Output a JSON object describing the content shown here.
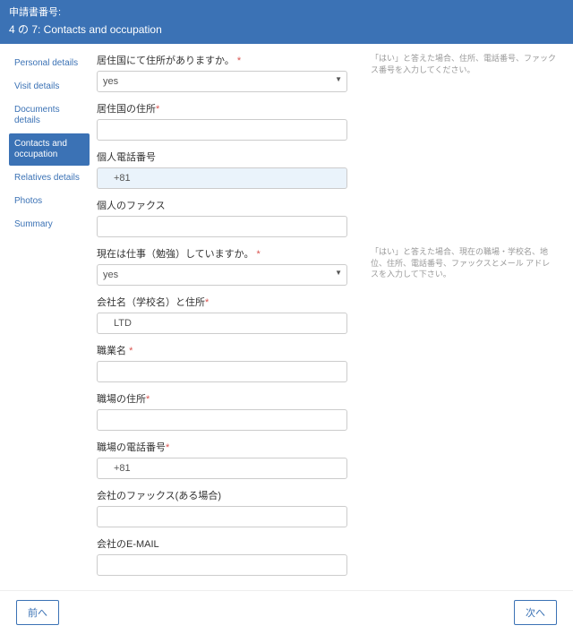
{
  "header": {
    "appno_label": "申請書番号:",
    "step": "4 の 7: Contacts and occupation"
  },
  "sidebar": {
    "items": [
      {
        "label": "Personal details"
      },
      {
        "label": "Visit details"
      },
      {
        "label": "Documents details"
      },
      {
        "label": "Contacts and occupation"
      },
      {
        "label": "Relatives details"
      },
      {
        "label": "Photos"
      },
      {
        "label": "Summary"
      }
    ],
    "active_index": 3
  },
  "form": {
    "q_has_address": {
      "label": "居住国にて住所がありますか。",
      "required": "*",
      "value": "yes",
      "hint": "「はい」と答えた場合、住所、電話番号、ファックス番号を入力してください。"
    },
    "home_address": {
      "label": "居住国の住所",
      "required": "*",
      "value": ""
    },
    "personal_phone": {
      "label": "個人電話番号",
      "value": "+81"
    },
    "personal_fax": {
      "label": "個人のファクス",
      "value": ""
    },
    "q_working": {
      "label": "現在は仕事（勉強）していますか。",
      "required": "*",
      "value": "yes",
      "hint": "「はい」と答えた場合、現在の職場・学校名、地位、住所、電話番号、ファックスとメール アドレスを入力して下さい。"
    },
    "company_name": {
      "label": "会社名（学校名）と住所",
      "required": "*",
      "value": "LTD"
    },
    "job_title": {
      "label": "職業名",
      "required": "*",
      "value": ""
    },
    "work_address": {
      "label": "職場の住所",
      "required": "*",
      "value": ""
    },
    "work_phone": {
      "label": "職場の電話番号",
      "required": "*",
      "value": "+81"
    },
    "work_fax": {
      "label": "会社のファックス(ある場合)",
      "value": ""
    },
    "work_email": {
      "label": "会社のE-MAIL",
      "value": ""
    }
  },
  "footer": {
    "prev": "前へ",
    "next": "次へ"
  }
}
